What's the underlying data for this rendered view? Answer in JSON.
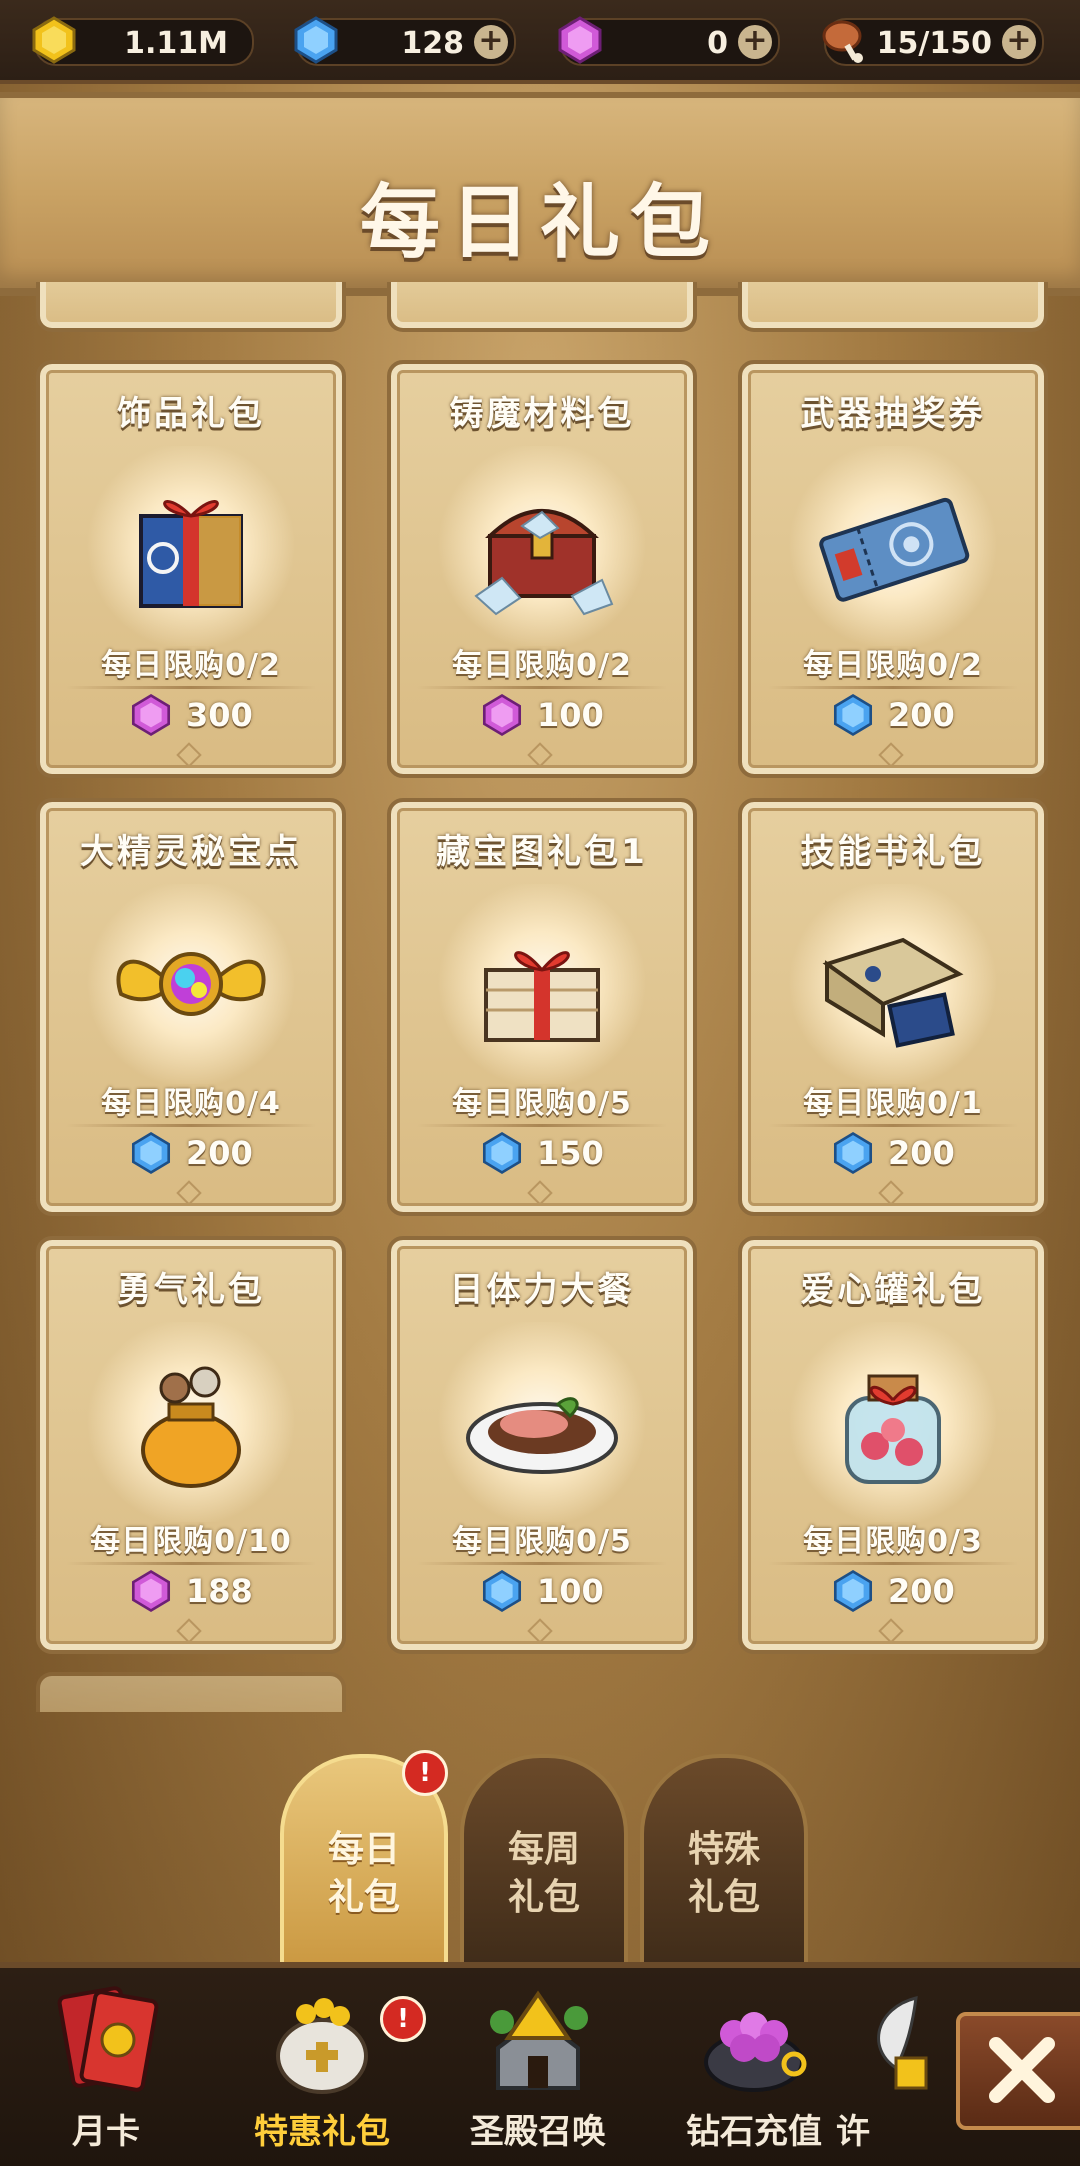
{
  "resources": {
    "gold": "1.11M",
    "diamond": "128",
    "gem": "0",
    "stamina": "15/150",
    "plus_symbol": "+"
  },
  "page_title": "每日礼包",
  "cards": [
    {
      "name": "饰品礼包",
      "limit": "每日限购0/2",
      "currency": "gem",
      "price": "300",
      "icon": "gift-box-icon"
    },
    {
      "name": "铸魔材料包",
      "limit": "每日限购0/2",
      "currency": "gem",
      "price": "100",
      "icon": "treasure-chest-icon"
    },
    {
      "name": "武器抽奖券",
      "limit": "每日限购0/2",
      "currency": "diamond",
      "price": "200",
      "icon": "ticket-icon"
    },
    {
      "name": "大精灵秘宝点",
      "limit": "每日限购0/4",
      "currency": "diamond",
      "price": "200",
      "icon": "winged-orb-icon"
    },
    {
      "name": "藏宝图礼包1",
      "limit": "每日限购0/5",
      "currency": "diamond",
      "price": "150",
      "icon": "map-gift-icon"
    },
    {
      "name": "技能书礼包",
      "limit": "每日限购0/1",
      "currency": "diamond",
      "price": "200",
      "icon": "skill-book-icon"
    },
    {
      "name": "勇气礼包",
      "limit": "每日限购0/10",
      "currency": "gem",
      "price": "188",
      "icon": "pouch-icon"
    },
    {
      "name": "日体力大餐",
      "limit": "每日限购0/5",
      "currency": "diamond",
      "price": "100",
      "icon": "meal-plate-icon"
    },
    {
      "name": "爱心罐礼包",
      "limit": "每日限购0/3",
      "currency": "diamond",
      "price": "200",
      "icon": "heart-jar-icon"
    }
  ],
  "sub_tabs": [
    {
      "line1": "每日",
      "line2": "礼包",
      "active": true,
      "badge": "!"
    },
    {
      "line1": "每周",
      "line2": "礼包",
      "active": false
    },
    {
      "line1": "特殊",
      "line2": "礼包",
      "active": false
    }
  ],
  "bottom_nav": [
    {
      "label": "月卡",
      "icon": "card-icon"
    },
    {
      "label": "特惠礼包",
      "icon": "gift-sack-icon",
      "active": true,
      "badge": "!"
    },
    {
      "label": "圣殿召唤",
      "icon": "temple-icon"
    },
    {
      "label": "钻石充值",
      "icon": "gem-cauldron-icon"
    },
    {
      "label": "许",
      "icon": "wing-icon"
    }
  ],
  "colors": {
    "gold": "#f2c21b",
    "diamond": "#4aa3f0",
    "gem": "#d05ad8",
    "active_tab": "#ffce3b",
    "badge": "#d42a22"
  }
}
